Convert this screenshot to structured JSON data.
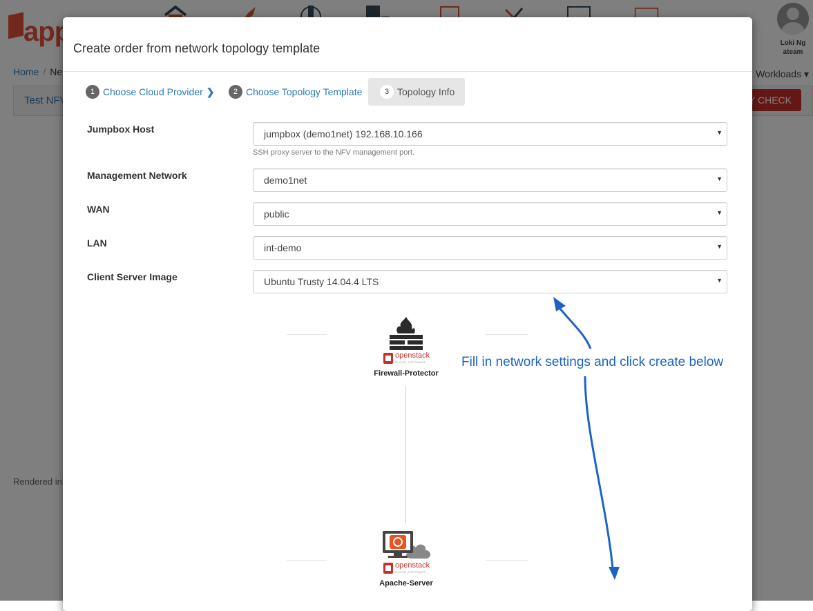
{
  "app": {
    "logo_text": "app",
    "user": {
      "name": "Loki Ng",
      "team": "ateam"
    },
    "breadcrumb": {
      "home": "Home",
      "sep": "/",
      "current": "Ne"
    },
    "workloads_label": "Workloads",
    "panel_title": "Test NFV",
    "check_button": "TY CHECK",
    "rendered_text": "Rendered in",
    "nav_icons": [
      "home-icon",
      "rocket-icon",
      "server-icon",
      "database-icon",
      "orders-icon",
      "tools-icon",
      "reports-icon",
      "layout-icon"
    ]
  },
  "modal": {
    "title": "Create order from network topology template",
    "steps": [
      {
        "num": "1",
        "label": "Choose Cloud Provider",
        "state": "link"
      },
      {
        "num": "2",
        "label": "Choose Topology Template",
        "state": "link"
      },
      {
        "num": "3",
        "label": "Topology Info",
        "state": "active"
      }
    ],
    "fields": {
      "jumpbox": {
        "label": "Jumpbox Host",
        "value": "jumpbox (demo1net) 192.168.10.166",
        "help": "SSH proxy server to the NFV management port."
      },
      "management": {
        "label": "Management Network",
        "value": "demo1net"
      },
      "wan": {
        "label": "WAN",
        "value": "public"
      },
      "lan": {
        "label": "LAN",
        "value": "int-demo"
      },
      "client_image": {
        "label": "Client Server Image",
        "value": "Ubuntu Trusty 14.04.4 LTS"
      }
    },
    "topology": {
      "firewall_label": "Firewall-Protector",
      "server_label": "Apache-Server",
      "badge_text": "openstack",
      "badge_subtext": "CLOUD SOFTWARE"
    },
    "annotation": "Fill in network settings and click create below"
  },
  "colors": {
    "link": "#2a7ab8",
    "danger": "#c9302c",
    "annotation": "#1c63c5",
    "openstack_red": "#c6302b"
  }
}
